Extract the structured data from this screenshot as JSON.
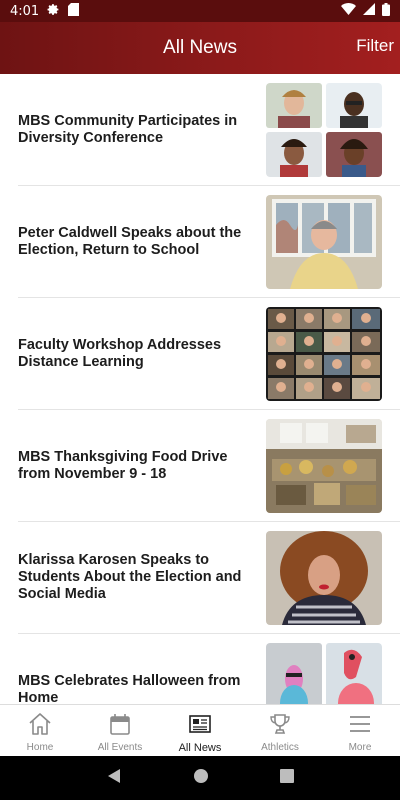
{
  "status": {
    "time": "4:01"
  },
  "header": {
    "title": "All News",
    "filter_label": "Filter"
  },
  "news": [
    {
      "title": "MBS Community Participates in Diversity Conference",
      "thumb": "zoom-grid-four"
    },
    {
      "title": "Peter Caldwell Speaks about the Election, Return to School",
      "thumb": "man-by-window"
    },
    {
      "title": "Faculty Workshop Addresses Distance Learning",
      "thumb": "zoom-gallery"
    },
    {
      "title": "MBS Thanksgiving Food Drive from November 9 - 18",
      "thumb": "food-room"
    },
    {
      "title": "Klarissa Karosen Speaks to Students About the Election and Social Media",
      "thumb": "woman-curly-hair"
    },
    {
      "title": "MBS Celebrates Halloween from Home",
      "thumb": "halloween-costumes"
    }
  ],
  "bottom_nav": [
    {
      "label": "Home",
      "icon": "home-icon",
      "active": false
    },
    {
      "label": "All Events",
      "icon": "calendar-icon",
      "active": false
    },
    {
      "label": "All News",
      "icon": "newspaper-icon",
      "active": true
    },
    {
      "label": "Athletics",
      "icon": "trophy-icon",
      "active": false
    },
    {
      "label": "More",
      "icon": "menu-icon",
      "active": false
    }
  ],
  "colors": {
    "header": "#8c1a1a",
    "status_bar": "#5a0d0d"
  }
}
